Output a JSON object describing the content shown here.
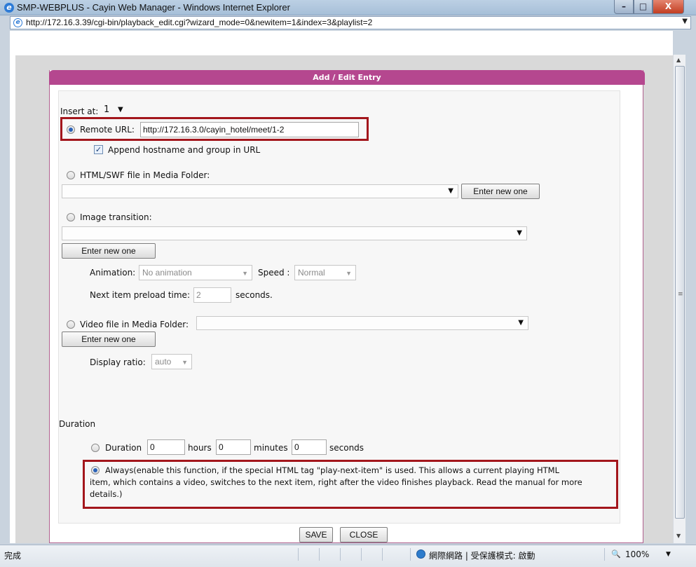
{
  "window": {
    "title": "SMP-WEBPLUS - Cayin Web Manager - Windows Internet Explorer",
    "minimize": "–",
    "maximize": "□",
    "close": "X"
  },
  "addressbar": {
    "url": "http://172.16.3.39/cgi-bin/playback_edit.cgi?wizard_mode=0&newitem=1&index=3&playlist=2",
    "dropdown": "▼"
  },
  "dialog": {
    "title": "Add / Edit Entry",
    "insert_at_label": "Insert at:",
    "insert_at_value": "1",
    "remote_url": {
      "label": "Remote URL:",
      "value": "http://172.16.3.0/cayin_hotel/meet/1-2",
      "selected": true,
      "append_checkbox_label": "Append hostname and group in URL",
      "append_checked": true
    },
    "html_swf": {
      "label": "HTML/SWF file in Media Folder:",
      "enter_new_label": "Enter new one"
    },
    "image_transition": {
      "label": "Image transition:",
      "enter_new_label": "Enter new one",
      "animation_label": "Animation:",
      "animation_value": "No animation",
      "speed_label": "Speed :",
      "speed_value": "Normal",
      "preload_label": "Next item preload time:",
      "preload_value": "2",
      "preload_unit": "seconds."
    },
    "video_file": {
      "label": "Video file in Media Folder:",
      "enter_new_label": "Enter new one",
      "display_ratio_label": "Display ratio:",
      "display_ratio_value": "auto"
    },
    "duration": {
      "heading": "Duration",
      "duration_label": "Duration",
      "hours_value": "0",
      "hours_label": "hours",
      "minutes_value": "0",
      "minutes_label": "minutes",
      "seconds_value": "0",
      "seconds_label": "seconds",
      "always_line1": "Always(enable this function, if the special HTML tag \"play-next-item\" is used. This allows a current playing HTML",
      "always_line2": "item, which contains a video, switches to the next item, right after the video finishes playback. Read the manual for more",
      "always_line3": "details.)",
      "always_selected": true
    },
    "save_label": "SAVE",
    "close_label": "CLOSE"
  },
  "statusbar": {
    "left_text": "完成",
    "zone_text": "網際網路 | 受保護模式: 啟動",
    "zoom": "100%"
  },
  "colors": {
    "dialog_header": "#b5478f",
    "highlight_border": "#a3161c",
    "titlebar": "#a6bfd8"
  },
  "icons": {
    "browser": "ie-icon",
    "zone": "globe-icon",
    "zoom": "zoom-icon"
  }
}
